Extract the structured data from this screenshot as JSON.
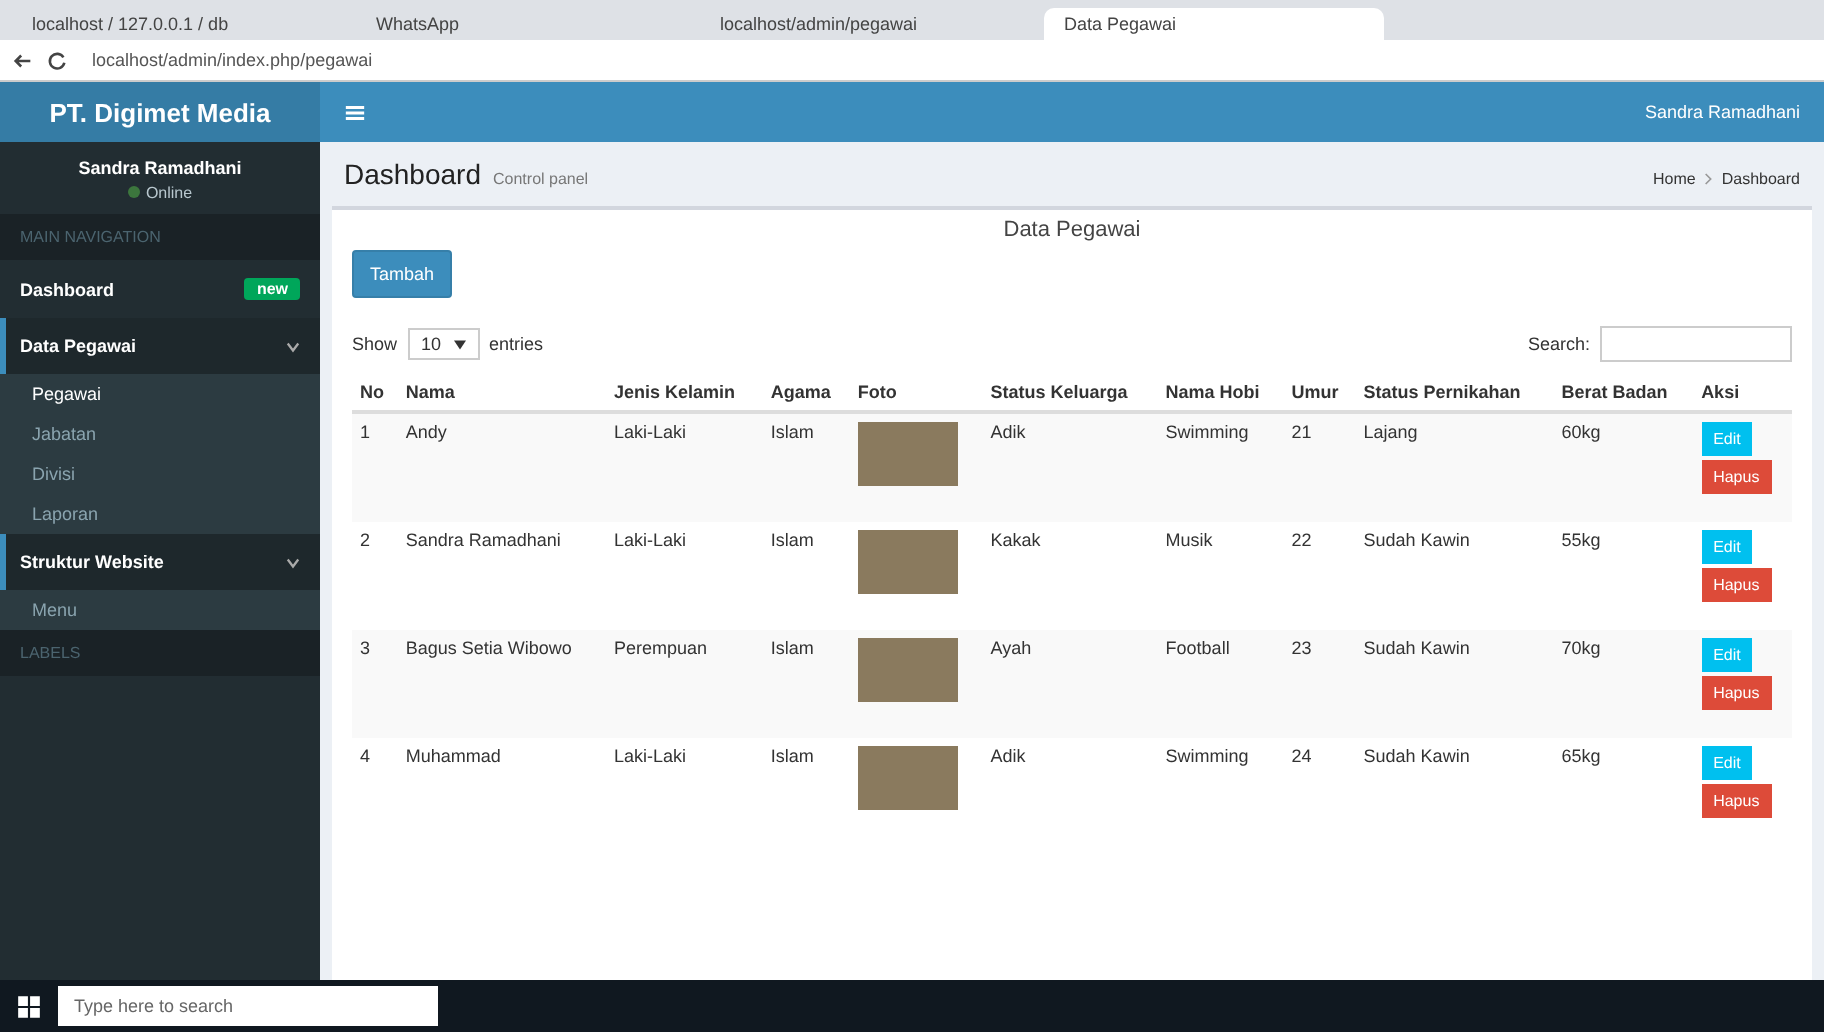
{
  "browser": {
    "tabs": [
      {
        "label": "localhost / 127.0.0.1 / db",
        "selected": false
      },
      {
        "label": "WhatsApp",
        "selected": false
      },
      {
        "label": "localhost/admin/pegawai",
        "selected": false
      },
      {
        "label": "Data Pegawai",
        "selected": true
      }
    ],
    "address": "localhost/admin/index.php/pegawai"
  },
  "header": {
    "brand": "PT. Digimet Media",
    "user": "Sandra Ramadhani"
  },
  "sidebar": {
    "user_name": "Sandra Ramadhani",
    "user_status": "Online",
    "section": "MAIN NAVIGATION",
    "items": [
      {
        "label": "Dashboard",
        "badge": "new"
      },
      {
        "label": "Data Pegawai",
        "expanded": true,
        "children": [
          {
            "label": "Pegawai",
            "selected": true
          },
          {
            "label": "Jabatan",
            "selected": false
          },
          {
            "label": "Divisi",
            "selected": false
          },
          {
            "label": "Laporan",
            "selected": false
          }
        ]
      },
      {
        "label": "Struktur Website",
        "expanded": true,
        "children": [
          {
            "label": "Menu",
            "selected": false
          }
        ]
      }
    ],
    "footer_label": "LABELS"
  },
  "page": {
    "title": "Dashboard",
    "subtitle": "Control panel",
    "breadcrumb": [
      "Home",
      "Dashboard"
    ],
    "heading": "Data Pegawai",
    "add_button": "Tambah",
    "show_label": "Show",
    "show_value": "10",
    "entries_label": "entries",
    "search_label": "Search:"
  },
  "table": {
    "columns": [
      "No",
      "Nama",
      "Jenis Kelamin",
      "Agama",
      "Foto",
      "Status Keluarga",
      "Nama Hobi",
      "Umur",
      "Status Pernikahan",
      "Berat Badan",
      "Aksi"
    ],
    "rows": [
      {
        "cells": [
          "1",
          "Andy",
          "Laki-Laki",
          "Islam",
          "",
          "Adik",
          "Swimming",
          "21",
          "Lajang",
          "60kg"
        ],
        "edit_label": "Edit",
        "delete_label": "Hapus"
      },
      {
        "cells": [
          "2",
          "Sandra Ramadhani",
          "Laki-Laki",
          "Islam",
          "",
          "Kakak",
          "Musik",
          "22",
          "Sudah Kawin",
          "55kg"
        ],
        "edit_label": "Edit",
        "delete_label": "Hapus"
      },
      {
        "cells": [
          "3",
          "Bagus Setia Wibowo",
          "Perempuan",
          "Islam",
          "",
          "Ayah",
          "Football",
          "23",
          "Sudah Kawin",
          "70kg"
        ],
        "edit_label": "Edit",
        "delete_label": "Hapus"
      },
      {
        "cells": [
          "4",
          "Muhammad",
          "Laki-Laki",
          "Islam",
          "",
          "Adik",
          "Swimming",
          "24",
          "Sudah Kawin",
          "65kg"
        ],
        "edit_label": "Edit",
        "delete_label": "Hapus"
      }
    ]
  },
  "taskbar": {
    "search_placeholder": "Type here to search"
  }
}
